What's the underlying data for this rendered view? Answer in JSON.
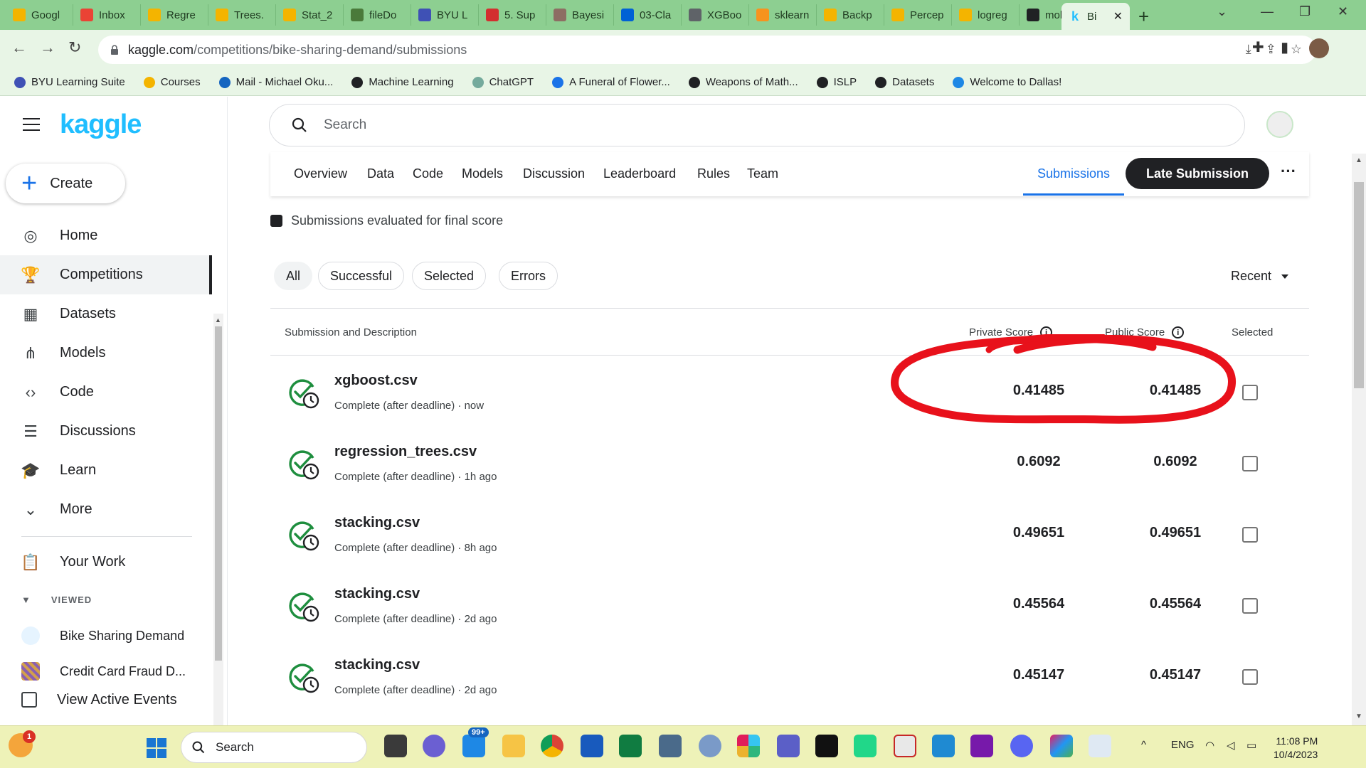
{
  "browser": {
    "tabs": [
      {
        "label": "Googl",
        "color": "#f4b400"
      },
      {
        "label": "Inbox",
        "color": "#ea4335"
      },
      {
        "label": "Regre",
        "color": "#f4b400"
      },
      {
        "label": "Trees.",
        "color": "#f4b400"
      },
      {
        "label": "Stat_2",
        "color": "#f4b400"
      },
      {
        "label": "fileDo",
        "color": "#4a7a3a"
      },
      {
        "label": "BYU L",
        "color": "#3f51b5"
      },
      {
        "label": "5. Sup",
        "color": "#d32f2f"
      },
      {
        "label": "Bayesi",
        "color": "#8d6e63"
      },
      {
        "label": "03-Cla",
        "color": "#0061d5"
      },
      {
        "label": "XGBoo",
        "color": "#5f6368"
      },
      {
        "label": "sklearn",
        "color": "#f7931e"
      },
      {
        "label": "Backp",
        "color": "#f4b400"
      },
      {
        "label": "Percep",
        "color": "#f4b400"
      },
      {
        "label": "logreg",
        "color": "#f4b400"
      },
      {
        "label": "moku",
        "color": "#202124"
      }
    ],
    "active_tab": {
      "label": "Bi",
      "favicon": "k"
    },
    "url_domain": "kaggle.com",
    "url_path": "/competitions/bike-sharing-demand/submissions",
    "bookmarks": [
      "BYU Learning Suite",
      "Courses",
      "Mail - Michael Oku...",
      "Machine Learning",
      "ChatGPT",
      "A Funeral of Flower...",
      "Weapons of Math...",
      "ISLP",
      "Datasets",
      "Welcome to Dallas!"
    ]
  },
  "sidebar": {
    "logo": "kaggle",
    "create_label": "Create",
    "nav": [
      {
        "label": "Home",
        "icon": "compass-icon"
      },
      {
        "label": "Competitions",
        "icon": "trophy-icon"
      },
      {
        "label": "Datasets",
        "icon": "table-icon"
      },
      {
        "label": "Models",
        "icon": "models-icon"
      },
      {
        "label": "Code",
        "icon": "code-icon"
      },
      {
        "label": "Discussions",
        "icon": "discussion-icon"
      },
      {
        "label": "Learn",
        "icon": "graduation-cap-icon"
      },
      {
        "label": "More",
        "icon": "chevron-down-icon"
      }
    ],
    "your_work": "Your Work",
    "viewed_label": "VIEWED",
    "viewed_items": [
      "Bike Sharing Demand",
      "Credit Card Fraud D..."
    ],
    "view_active_events": "View Active Events"
  },
  "search": {
    "placeholder": "Search"
  },
  "competition_tabs": [
    "Overview",
    "Data",
    "Code",
    "Models",
    "Discussion",
    "Leaderboard",
    "Rules",
    "Team"
  ],
  "selected_tab": "Submissions",
  "late_submission_label": "Late Submission",
  "eval_note": "Submissions evaluated for final score",
  "filters": [
    "All",
    "Successful",
    "Selected",
    "Errors"
  ],
  "sort_label": "Recent",
  "table": {
    "headers": {
      "submission": "Submission and Description",
      "private": "Private Score",
      "public": "Public Score",
      "selected": "Selected"
    },
    "rows": [
      {
        "file": "xgboost.csv",
        "meta": "Complete (after deadline) · now",
        "private": "0.41485",
        "public": "0.41485"
      },
      {
        "file": "regression_trees.csv",
        "meta": "Complete (after deadline) · 1h ago",
        "private": "0.6092",
        "public": "0.6092"
      },
      {
        "file": "stacking.csv",
        "meta": "Complete (after deadline) · 8h ago",
        "private": "0.49651",
        "public": "0.49651"
      },
      {
        "file": "stacking.csv",
        "meta": "Complete (after deadline) · 2d ago",
        "private": "0.45564",
        "public": "0.45564"
      },
      {
        "file": "stacking.csv",
        "meta": "Complete (after deadline) · 2d ago",
        "private": "0.45147",
        "public": "0.45147"
      }
    ]
  },
  "annotation": {
    "color": "#e8111b"
  },
  "taskbar": {
    "weather_badge": "1",
    "search_label": "Search",
    "mail_badge": "99+",
    "language": "ENG",
    "time": "11:08 PM",
    "date": "10/4/2023"
  }
}
